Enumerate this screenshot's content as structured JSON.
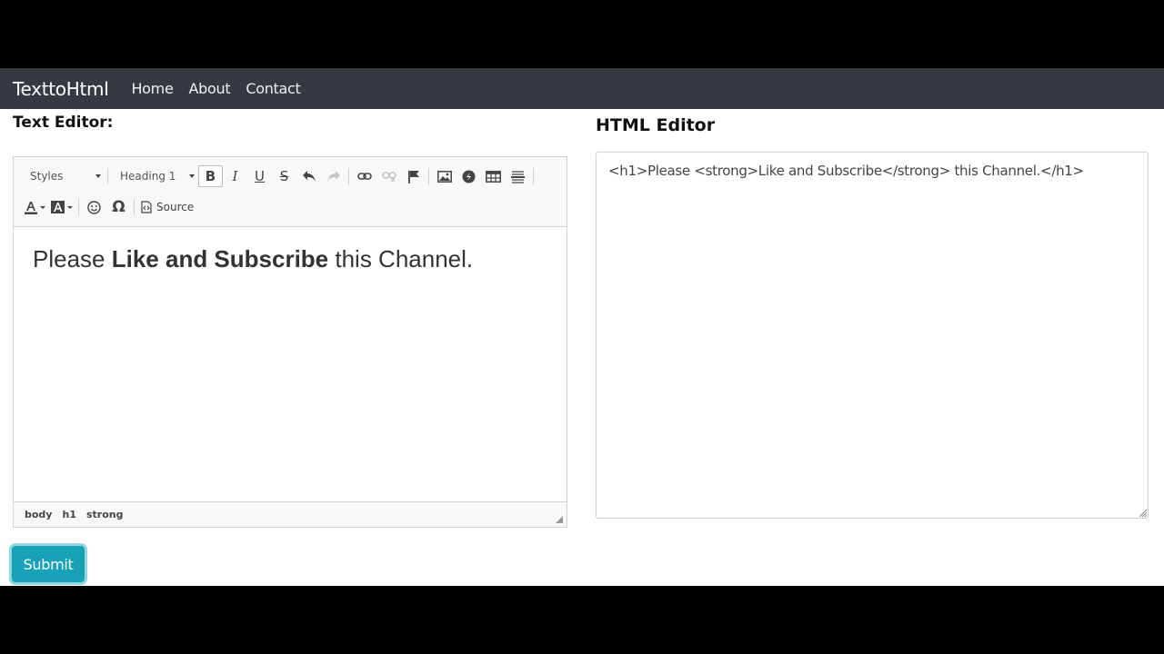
{
  "navbar": {
    "brand": "TexttoHtml",
    "links": [
      "Home",
      "About",
      "Contact"
    ]
  },
  "text_editor": {
    "heading": "Text Editor:",
    "toolbar": {
      "styles_label": "Styles",
      "format_label": "Heading 1",
      "bold_glyph": "B",
      "italic_glyph": "I",
      "underline_glyph": "U",
      "strike_glyph": "S",
      "source_label": "Source"
    },
    "content": {
      "part1": "Please ",
      "bold": "Like and Subscribe",
      "part2": " this Channel."
    },
    "path": [
      "body",
      "h1",
      "strong"
    ]
  },
  "html_editor": {
    "heading": "HTML Editor",
    "value": "<h1>Please <strong>Like and Subscribe</strong> this Channel.</h1>"
  },
  "submit_label": "Submit",
  "colors": {
    "navbar": "#343a40",
    "submit": "#17a2b8"
  }
}
